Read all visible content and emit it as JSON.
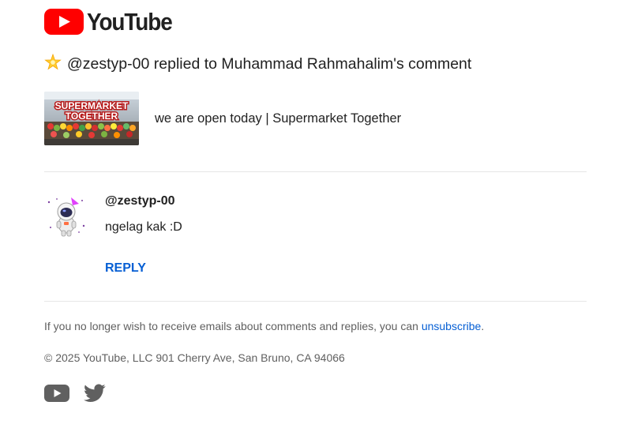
{
  "brand": {
    "wordmark": "YouTube",
    "logo_icon": "youtube-play-icon",
    "accent": "#ff0000"
  },
  "notification": {
    "emoji_icon": "glowing-star-icon",
    "headline": "@zestyp-00 replied to Muhammad Rahmahalim's comment"
  },
  "video": {
    "thumbnail_text": "SUPERMARKET TOGETHER",
    "title": "we are open today | Supermarket Together"
  },
  "reply": {
    "author": "@zestyp-00",
    "avatar_icon": "astronaut-avatar-icon",
    "text": "ngelag kak :D",
    "action_label": "REPLY",
    "action_color": "#065fd4"
  },
  "footer": {
    "unsubscribe_prefix": "If you no longer wish to receive emails about comments and replies, you can ",
    "unsubscribe_link": "unsubscribe",
    "unsubscribe_suffix": ".",
    "copyright": "© 2025 YouTube, LLC 901 Cherry Ave, San Bruno, CA 94066",
    "social_icons": [
      "youtube-icon",
      "twitter-icon"
    ]
  }
}
